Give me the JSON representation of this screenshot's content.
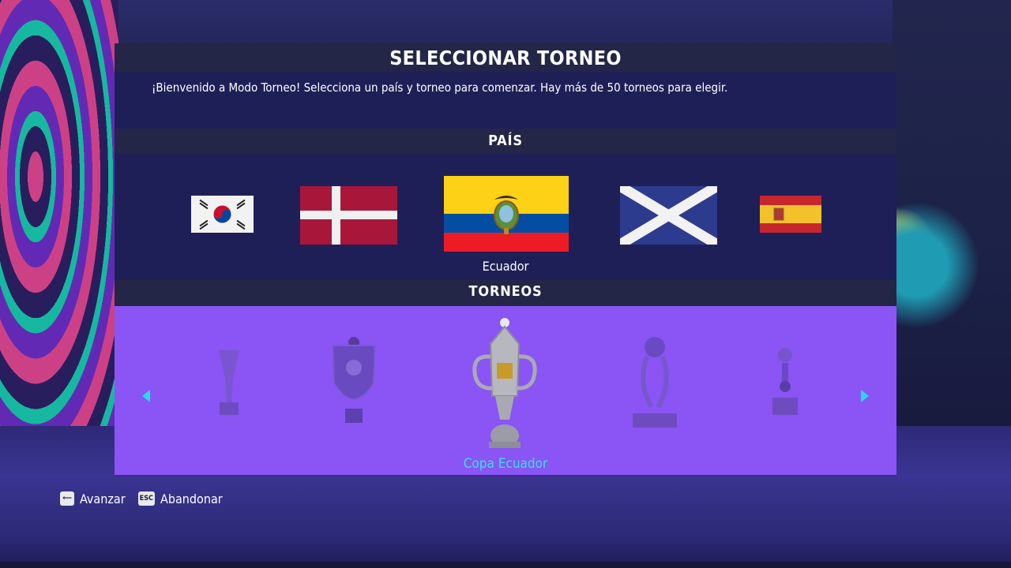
{
  "header": {
    "title": "SELECCIONAR TORNEO",
    "welcome": "¡Bienvenido a Modo Torneo!  Selecciona un país y torneo para comenzar. Hay más de 50 torneos para elegir."
  },
  "country": {
    "section_label": "PAÍS",
    "flags": [
      "korea-flag",
      "denmark-flag",
      "ecuador-flag",
      "scotland-flag",
      "spain-flag"
    ],
    "selected_label": "Ecuador"
  },
  "tournaments": {
    "section_label": "TORNEOS",
    "trophies": [
      "trophy-1",
      "trophy-2",
      "copa-ecuador-trophy",
      "trophy-4",
      "trophy-5"
    ],
    "selected_label": "Copa Ecuador"
  },
  "footer": {
    "advance_key": "⟵",
    "advance_label": "Avanzar",
    "quit_key": "ESC",
    "quit_label": "Abandonar"
  },
  "colors": {
    "accent": "#34e3f0",
    "tournament_bg": "#8a55f4",
    "panel_bg": "#1f1f58",
    "bar_bg": "#232646"
  }
}
